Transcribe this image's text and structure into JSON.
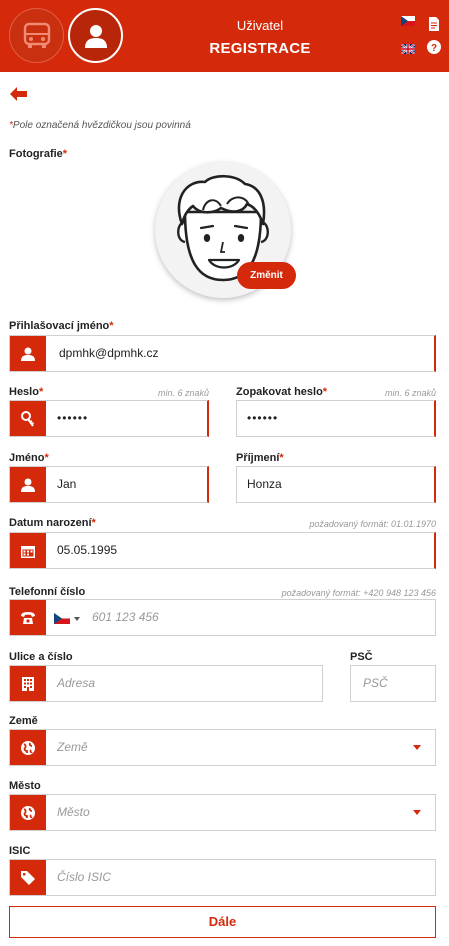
{
  "header": {
    "subtitle": "Uživatel",
    "title": "REGISTRACE",
    "bus_icon": "bus-icon",
    "user_icon": "user-icon",
    "brand_color": "#d42a0b"
  },
  "note": {
    "star": "*",
    "text": "Pole označená hvězdičkou jsou povinná"
  },
  "photo": {
    "label": "Fotografie",
    "change_label": "Změnit"
  },
  "form": {
    "required_star": "*",
    "login": {
      "label": "Přihlašovací jméno",
      "value": "dpmhk@dpmhk.cz",
      "icon": "user-icon"
    },
    "password": {
      "label": "Heslo",
      "hint": "min. 6 znaků",
      "value": "••••••",
      "icon": "key-icon"
    },
    "password_repeat": {
      "label": "Zopakovat heslo",
      "hint": "min. 6 znaků",
      "value": "••••••"
    },
    "first_name": {
      "label": "Jméno",
      "value": "Jan",
      "icon": "user-icon"
    },
    "last_name": {
      "label": "Příjmení",
      "value": "Honza"
    },
    "birth_date": {
      "label": "Datum narození",
      "hint": "požadovaný formát: 01.01.1970",
      "value": "05.05.1995",
      "icon": "calendar-icon"
    },
    "phone": {
      "label": "Telefonní číslo",
      "hint": "požadovaný formát: +420 948 123 456",
      "placeholder": "601 123 456",
      "icon": "phone-icon"
    },
    "street": {
      "label": "Ulice a číslo",
      "placeholder": "Adresa",
      "icon": "building-icon"
    },
    "zip": {
      "label": "PSČ",
      "placeholder": "PSČ"
    },
    "country": {
      "label": "Země",
      "placeholder": "Země",
      "icon": "globe-icon"
    },
    "city": {
      "label": "Město",
      "placeholder": "Město",
      "icon": "globe-icon"
    },
    "isic": {
      "label": "ISIC",
      "placeholder": "Číslo ISIC",
      "icon": "tag-icon"
    }
  },
  "next_button": "Dále"
}
